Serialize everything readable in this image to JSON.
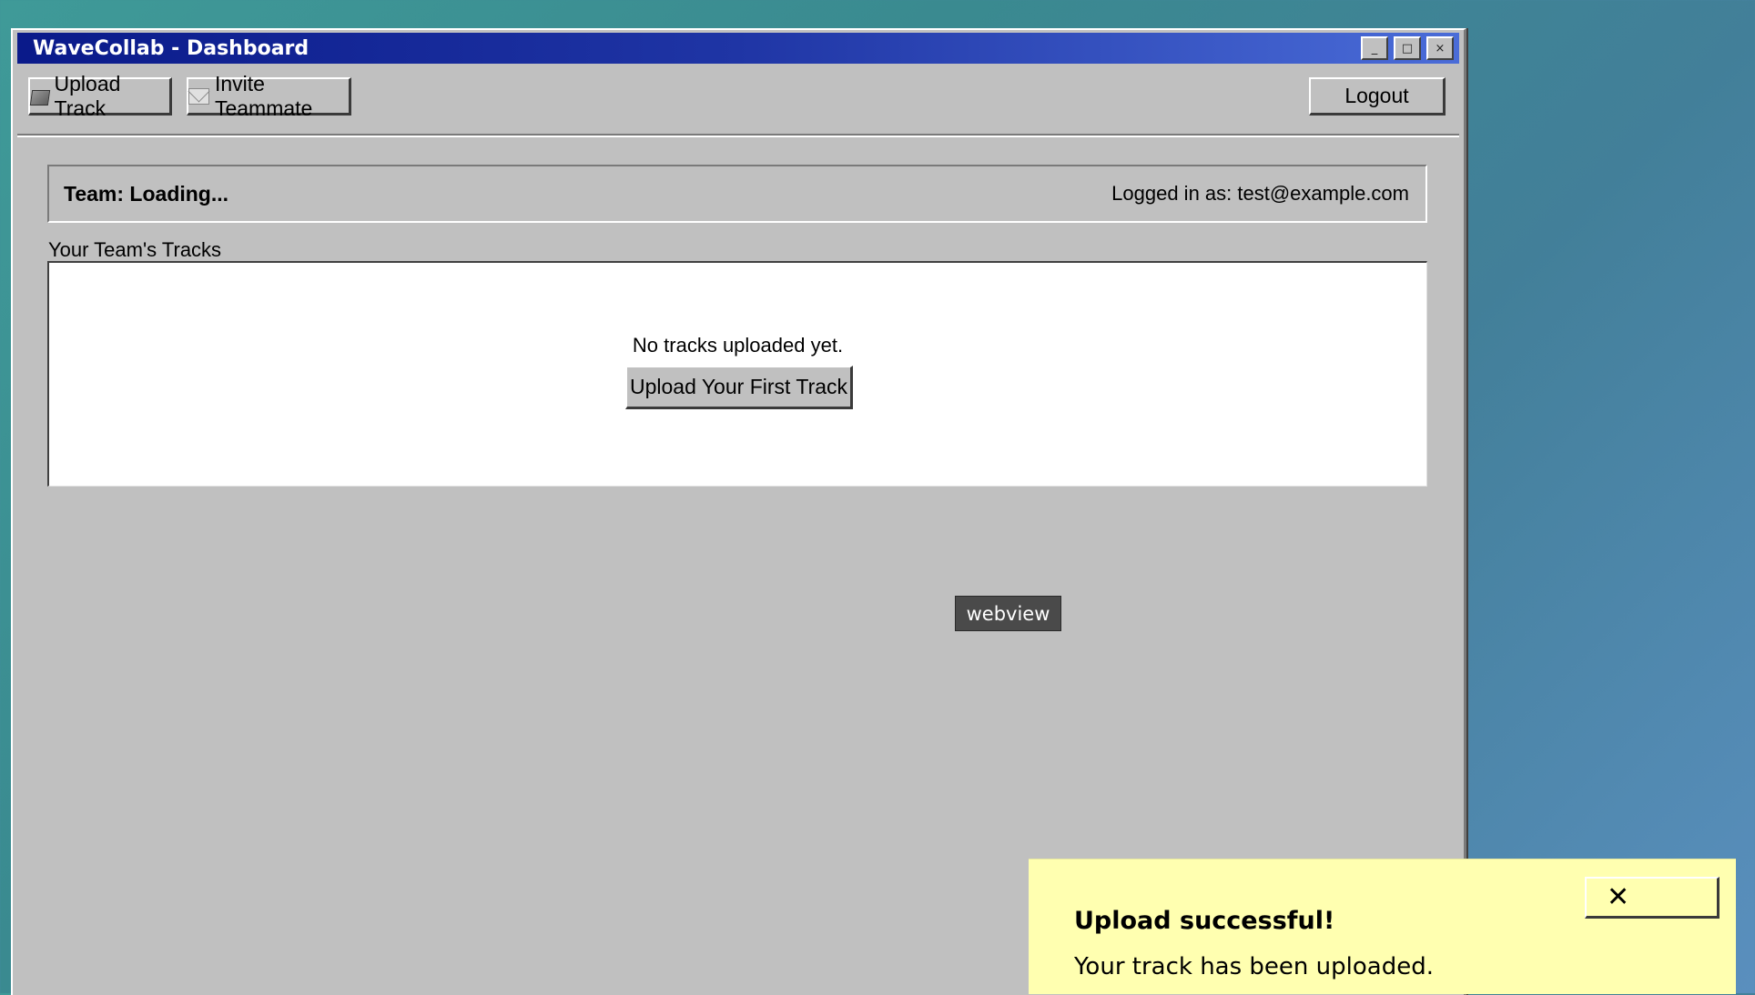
{
  "window": {
    "title": "WaveCollab - Dashboard",
    "controls": {
      "minimize": "_",
      "maximize": "□",
      "close": "×"
    }
  },
  "toolbar": {
    "upload_track_label": "Upload Track",
    "upload_track_icon": "folder-icon",
    "invite_teammate_label": "Invite Teammate",
    "invite_teammate_icon": "mail-icon",
    "logout_label": "Logout"
  },
  "team_panel": {
    "team_name": "Team: Loading...",
    "logged_in": "Logged in as: test@example.com"
  },
  "tracks": {
    "section_label": "Your Team's Tracks",
    "empty_message": "No tracks uploaded yet.",
    "upload_first_label": "Upload Your First Track"
  },
  "tooltip": {
    "text": "webview"
  },
  "toast": {
    "title": "Upload successful!",
    "message": "Your track has been uploaded.",
    "close_glyph": "✕"
  },
  "colors": {
    "titlebar_start": "#0a1a8a",
    "titlebar_end": "#4a6cd8",
    "window_face": "#c0c0c0",
    "toast_background": "#ffffb0"
  }
}
